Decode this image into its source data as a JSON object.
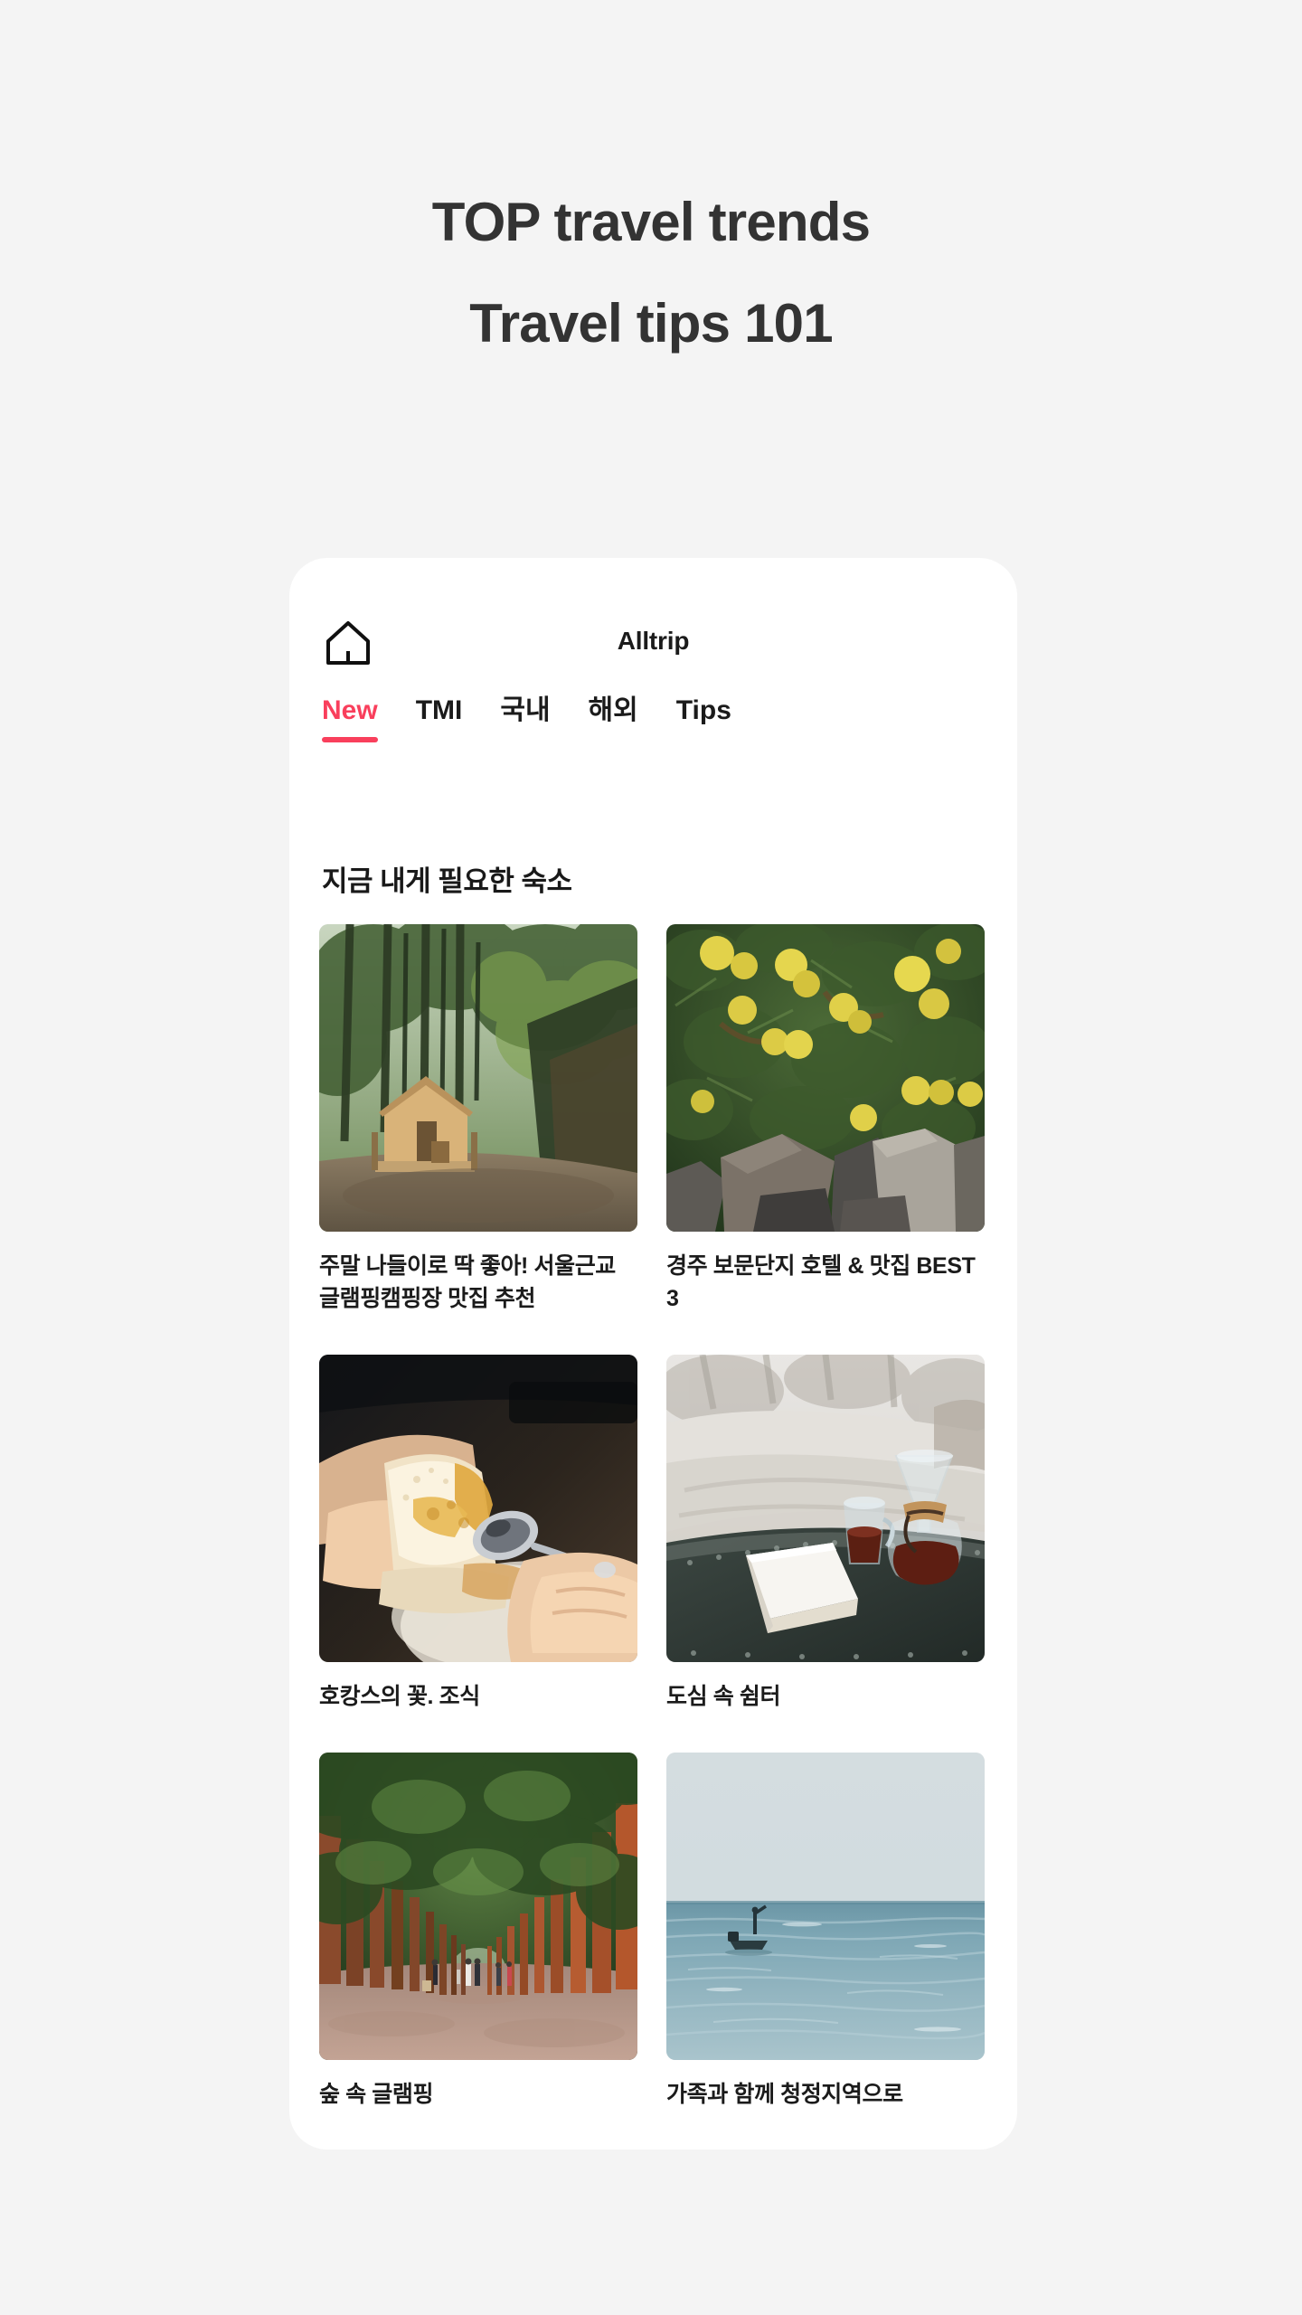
{
  "hero": {
    "line1": "TOP travel trends",
    "line2": "Travel tips 101"
  },
  "colors": {
    "page_background": "#f4f4f4",
    "phone_background": "#ffffff",
    "accent": "#f93f5c",
    "text_primary": "#1b1b1b",
    "hero_text": "#333333"
  },
  "appbar": {
    "home_icon": "home-icon",
    "title": "Alltrip"
  },
  "tabs": [
    {
      "label": "New",
      "active": true
    },
    {
      "label": "TMI",
      "active": false
    },
    {
      "label": "국내",
      "active": false
    },
    {
      "label": "해외",
      "active": false
    },
    {
      "label": "Tips",
      "active": false
    }
  ],
  "section": {
    "title": "지금 내게 필요한 숙소"
  },
  "cards": [
    {
      "caption": "주말 나들이로 딱 좋아! 서울근교 글램핑캠핑장 맛집 추천",
      "image": "forest-glamping-tent-photo"
    },
    {
      "caption": "경주 보문단지 호텔 & 맛집 BEST 3",
      "image": "tangerine-tree-stone-wall-photo"
    },
    {
      "caption": "호캉스의 꽃. 조식",
      "image": "hands-bread-jam-spoon-photo"
    },
    {
      "caption": "도심 속 쉼터",
      "image": "chemex-coffee-book-table-photo"
    },
    {
      "caption": "숲 속 글램핑",
      "image": "metasequoia-tree-lined-path-photo"
    },
    {
      "caption": "가족과 함께 청정지역으로",
      "image": "calm-sea-fishing-boat-photo"
    }
  ]
}
